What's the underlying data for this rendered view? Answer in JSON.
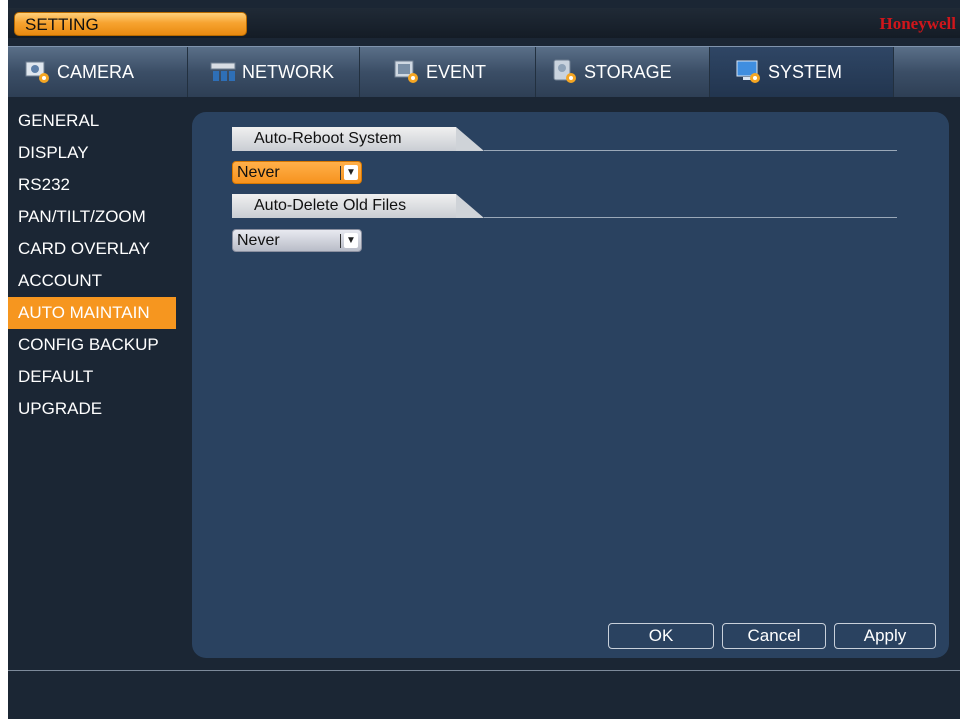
{
  "header": {
    "title": "SETTING",
    "brand": "Honeywell"
  },
  "tabs": [
    {
      "label": "CAMERA",
      "icon": "camera-icon",
      "active": false
    },
    {
      "label": "NETWORK",
      "icon": "network-icon",
      "active": false
    },
    {
      "label": "EVENT",
      "icon": "event-icon",
      "active": false
    },
    {
      "label": "STORAGE",
      "icon": "storage-icon",
      "active": false
    },
    {
      "label": "SYSTEM",
      "icon": "system-icon",
      "active": true
    }
  ],
  "sidebar": {
    "items": [
      {
        "label": "GENERAL"
      },
      {
        "label": "DISPLAY"
      },
      {
        "label": "RS232"
      },
      {
        "label": "PAN/TILT/ZOOM"
      },
      {
        "label": "CARD OVERLAY"
      },
      {
        "label": "ACCOUNT"
      },
      {
        "label": "AUTO MAINTAIN",
        "active": true
      },
      {
        "label": "CONFIG BACKUP"
      },
      {
        "label": "DEFAULT"
      },
      {
        "label": "UPGRADE"
      }
    ]
  },
  "main": {
    "auto_reboot": {
      "title": "Auto-Reboot System",
      "value": "Never"
    },
    "auto_delete": {
      "title": "Auto-Delete Old Files",
      "value": "Never"
    }
  },
  "buttons": {
    "ok": "OK",
    "cancel": "Cancel",
    "apply": "Apply"
  },
  "colors": {
    "accent": "#f6961f",
    "brand": "#d0161b",
    "panel": "#2a4260",
    "background": "#1b2634"
  }
}
